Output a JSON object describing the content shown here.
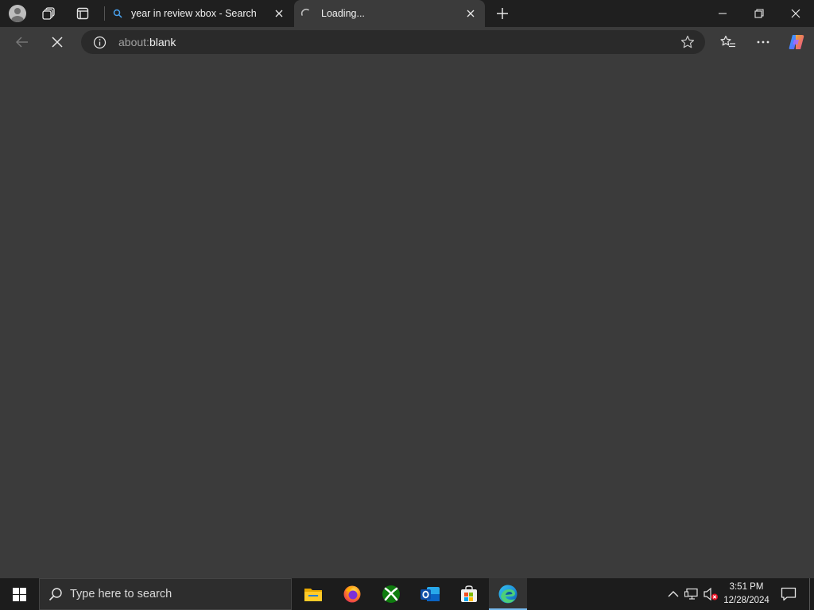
{
  "browser": {
    "tabs": [
      {
        "title": "year in review xbox - Search",
        "icon": "search-icon",
        "active": false
      },
      {
        "title": "Loading...",
        "icon": "loading-spinner-icon",
        "active": true
      }
    ],
    "address": {
      "scheme": "about:",
      "host": "blank"
    }
  },
  "taskbar": {
    "search_placeholder": "Type here to search",
    "apps": [
      "file-explorer-icon",
      "firefox-icon",
      "xbox-icon",
      "outlook-icon",
      "microsoft-store-icon",
      "edge-icon"
    ],
    "clock": {
      "time": "3:51 PM",
      "date": "12/28/2024"
    }
  },
  "colors": {
    "accent": "#76b9ed",
    "page_background": "#3b3b3b",
    "titlebar": "#1f1f1f",
    "taskbar": "#1c1c1c"
  }
}
